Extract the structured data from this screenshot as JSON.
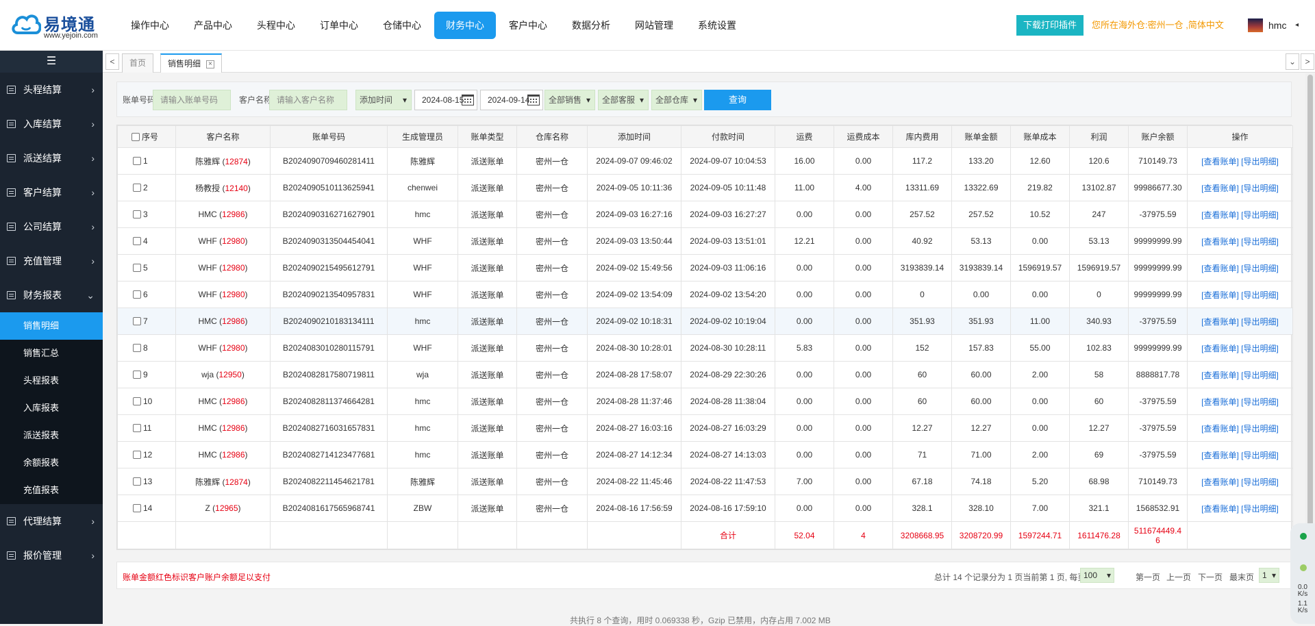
{
  "header": {
    "logo_title": "易境通",
    "logo_sub": "www.yejoin.com",
    "nav": [
      "操作中心",
      "产品中心",
      "头程中心",
      "订单中心",
      "仓储中心",
      "财务中心",
      "客户中心",
      "数据分析",
      "网站管理",
      "系统设置"
    ],
    "active_nav": 5,
    "download_btn": "下载打印插件",
    "location_text": "您所在海外仓:密州一仓 ,简体中文",
    "user_name": "hmc",
    "user_caret": "◂"
  },
  "sidebar": {
    "toggle_icon": "☰",
    "groups_top": [
      "头程结算",
      "入库结算",
      "派送结算",
      "客户结算",
      "公司结算",
      "充值管理"
    ],
    "open_group": "财务报表",
    "sub_items": [
      "销售明细",
      "销售汇总",
      "头程报表",
      "入库报表",
      "派送报表",
      "余额报表",
      "充值报表"
    ],
    "active_sub": 0,
    "groups_bottom": [
      "代理结算",
      "报价管理"
    ],
    "arrow_closed": "›",
    "arrow_open": "⌄"
  },
  "tabs": {
    "left_arrow": "<",
    "right_arrow": ">",
    "dropdown": "⌄",
    "home": "首页",
    "current": "销售明细",
    "close": "×"
  },
  "filter": {
    "bill_no_label": "账单号码",
    "bill_no_placeholder": "请输入账单号码",
    "customer_label": "客户名称",
    "customer_placeholder": "请输入客户名称",
    "time_type": "添加时间",
    "date_from": "2024-08-15",
    "date_to": "2024-09-14",
    "sales": "全部销售",
    "service": "全部客服",
    "warehouse": "全部仓库",
    "query_btn": "查询"
  },
  "table": {
    "columns": [
      "序号",
      "客户名称",
      "账单号码",
      "生成管理员",
      "账单类型",
      "仓库名称",
      "添加时间",
      "付款时间",
      "运费",
      "运费成本",
      "库内费用",
      "账单金额",
      "账单成本",
      "利润",
      "账户余额",
      "操作"
    ],
    "view_link": "[查看账单]",
    "export_link": "[导出明细]",
    "rows": [
      {
        "no": "1",
        "name": "陈雅辉",
        "code": "12874",
        "bill": "B2024090709460281411",
        "admin": "陈雅辉",
        "type": "派送账单",
        "wh": "密州一仓",
        "add": "2024-09-07 09:46:02",
        "pay": "2024-09-07 10:04:53",
        "fee": "16.00",
        "fee_cost": "0.00",
        "stock": "117.2",
        "amount": "133.20",
        "cost": "12.60",
        "profit": "120.6",
        "balance": "710149.73"
      },
      {
        "no": "2",
        "name": "杨教授",
        "code": "12140",
        "bill": "B2024090510113625941",
        "admin": "chenwei",
        "type": "派送账单",
        "wh": "密州一仓",
        "add": "2024-09-05 10:11:36",
        "pay": "2024-09-05 10:11:48",
        "fee": "11.00",
        "fee_cost": "4.00",
        "stock": "13311.69",
        "amount": "13322.69",
        "cost": "219.82",
        "profit": "13102.87",
        "balance": "99986677.30"
      },
      {
        "no": "3",
        "name": "HMC",
        "code": "12986",
        "bill": "B2024090316271627901",
        "admin": "hmc",
        "type": "派送账单",
        "wh": "密州一仓",
        "add": "2024-09-03 16:27:16",
        "pay": "2024-09-03 16:27:27",
        "fee": "0.00",
        "fee_cost": "0.00",
        "stock": "257.52",
        "amount": "257.52",
        "cost": "10.52",
        "profit": "247",
        "balance": "-37975.59"
      },
      {
        "no": "4",
        "name": "WHF",
        "code": "12980",
        "bill": "B2024090313504454041",
        "admin": "WHF",
        "type": "派送账单",
        "wh": "密州一仓",
        "add": "2024-09-03 13:50:44",
        "pay": "2024-09-03 13:51:01",
        "fee": "12.21",
        "fee_cost": "0.00",
        "stock": "40.92",
        "amount": "53.13",
        "cost": "0.00",
        "profit": "53.13",
        "balance": "99999999.99"
      },
      {
        "no": "5",
        "name": "WHF",
        "code": "12980",
        "bill": "B2024090215495612791",
        "admin": "WHF",
        "type": "派送账单",
        "wh": "密州一仓",
        "add": "2024-09-02 15:49:56",
        "pay": "2024-09-03 11:06:16",
        "fee": "0.00",
        "fee_cost": "0.00",
        "stock": "3193839.14",
        "amount": "3193839.14",
        "cost": "1596919.57",
        "profit": "1596919.57",
        "balance": "99999999.99"
      },
      {
        "no": "6",
        "name": "WHF",
        "code": "12980",
        "bill": "B2024090213540957831",
        "admin": "WHF",
        "type": "派送账单",
        "wh": "密州一仓",
        "add": "2024-09-02 13:54:09",
        "pay": "2024-09-02 13:54:20",
        "fee": "0.00",
        "fee_cost": "0.00",
        "stock": "0",
        "amount": "0.00",
        "cost": "0.00",
        "profit": "0",
        "balance": "99999999.99"
      },
      {
        "no": "7",
        "name": "HMC",
        "code": "12986",
        "bill": "B2024090210183134111",
        "admin": "hmc",
        "type": "派送账单",
        "wh": "密州一仓",
        "add": "2024-09-02 10:18:31",
        "pay": "2024-09-02 10:19:04",
        "fee": "0.00",
        "fee_cost": "0.00",
        "stock": "351.93",
        "amount": "351.93",
        "cost": "11.00",
        "profit": "340.93",
        "balance": "-37975.59"
      },
      {
        "no": "8",
        "name": "WHF",
        "code": "12980",
        "bill": "B2024083010280115791",
        "admin": "WHF",
        "type": "派送账单",
        "wh": "密州一仓",
        "add": "2024-08-30 10:28:01",
        "pay": "2024-08-30 10:28:11",
        "fee": "5.83",
        "fee_cost": "0.00",
        "stock": "152",
        "amount": "157.83",
        "cost": "55.00",
        "profit": "102.83",
        "balance": "99999999.99"
      },
      {
        "no": "9",
        "name": "wja",
        "code": "12950",
        "bill": "B2024082817580719811",
        "admin": "wja",
        "type": "派送账单",
        "wh": "密州一仓",
        "add": "2024-08-28 17:58:07",
        "pay": "2024-08-29 22:30:26",
        "fee": "0.00",
        "fee_cost": "0.00",
        "stock": "60",
        "amount": "60.00",
        "cost": "2.00",
        "profit": "58",
        "balance": "8888817.78"
      },
      {
        "no": "10",
        "name": "HMC",
        "code": "12986",
        "bill": "B2024082811374664281",
        "admin": "hmc",
        "type": "派送账单",
        "wh": "密州一仓",
        "add": "2024-08-28 11:37:46",
        "pay": "2024-08-28 11:38:04",
        "fee": "0.00",
        "fee_cost": "0.00",
        "stock": "60",
        "amount": "60.00",
        "cost": "0.00",
        "profit": "60",
        "balance": "-37975.59"
      },
      {
        "no": "11",
        "name": "HMC",
        "code": "12986",
        "bill": "B2024082716031657831",
        "admin": "hmc",
        "type": "派送账单",
        "wh": "密州一仓",
        "add": "2024-08-27 16:03:16",
        "pay": "2024-08-27 16:03:29",
        "fee": "0.00",
        "fee_cost": "0.00",
        "stock": "12.27",
        "amount": "12.27",
        "cost": "0.00",
        "profit": "12.27",
        "balance": "-37975.59"
      },
      {
        "no": "12",
        "name": "HMC",
        "code": "12986",
        "bill": "B2024082714123477681",
        "admin": "hmc",
        "type": "派送账单",
        "wh": "密州一仓",
        "add": "2024-08-27 14:12:34",
        "pay": "2024-08-27 14:13:03",
        "fee": "0.00",
        "fee_cost": "0.00",
        "stock": "71",
        "amount": "71.00",
        "cost": "2.00",
        "profit": "69",
        "balance": "-37975.59"
      },
      {
        "no": "13",
        "name": "陈雅辉",
        "code": "12874",
        "bill": "B2024082211454621781",
        "admin": "陈雅辉",
        "type": "派送账单",
        "wh": "密州一仓",
        "add": "2024-08-22 11:45:46",
        "pay": "2024-08-22 11:47:53",
        "fee": "7.00",
        "fee_cost": "0.00",
        "stock": "67.18",
        "amount": "74.18",
        "cost": "5.20",
        "profit": "68.98",
        "balance": "710149.73"
      },
      {
        "no": "14",
        "name": "Z",
        "code": "12965",
        "bill": "B2024081617565968741",
        "admin": "ZBW",
        "type": "派送账单",
        "wh": "密州一仓",
        "add": "2024-08-16 17:56:59",
        "pay": "2024-08-16 17:59:10",
        "fee": "0.00",
        "fee_cost": "0.00",
        "stock": "328.1",
        "amount": "328.10",
        "cost": "7.00",
        "profit": "321.1",
        "balance": "1568532.91"
      }
    ],
    "total": {
      "label": "合计",
      "fee": "52.04",
      "fee_cost": "4",
      "stock": "3208668.95",
      "amount": "3208720.99",
      "cost": "1597244.71",
      "profit": "1611476.28",
      "balance_line1": "511674449.4",
      "balance_line2": "6"
    }
  },
  "footer": {
    "note": "账单金额红色标识客户账户余额足以支付",
    "summary": "总计 14 个记录分为 1 页当前第 1 页, 每页",
    "page_size": "100",
    "first": "第一页",
    "prev": "上一页",
    "next": "下一页",
    "last": "最末页",
    "page_no": "1",
    "exec_info": "共执行 8 个查询，用时 0.069338 秒，Gzip 已禁用，内存占用 7.002 MB"
  },
  "widget": {
    "val1": "0.0",
    "unit1": "K/s",
    "val2": "1.1",
    "unit2": "K/s"
  },
  "colors": {
    "accent": "#1b9aee",
    "sidebar": "#1b2430",
    "red": "#e60012",
    "orange": "#f39800"
  }
}
